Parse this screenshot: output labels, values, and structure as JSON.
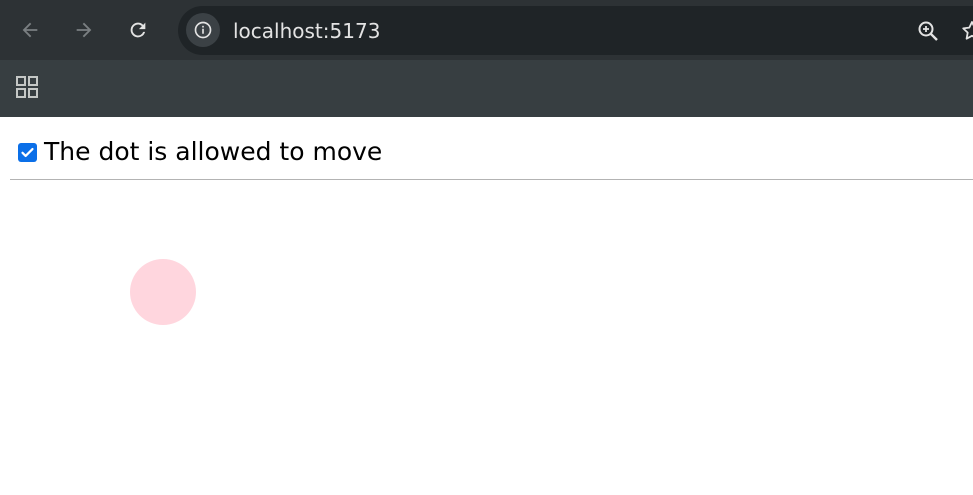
{
  "browser": {
    "url": "localhost:5173",
    "back_label": "Back",
    "forward_label": "Forward",
    "reload_label": "Reload",
    "site_info_label": "View site information",
    "zoom_label": "Zoom",
    "bookmark_label": "Bookmark this tab",
    "apps_label": "Apps"
  },
  "page": {
    "checkbox_checked": true,
    "checkbox_label": "The dot is allowed to move",
    "dot_color": "#ffd6de"
  },
  "colors": {
    "checkbox_accent": "#0b6fe8",
    "toolbar": "#2d3235",
    "bookmarks_bar": "#373e41",
    "omnibox": "#1f2427"
  }
}
